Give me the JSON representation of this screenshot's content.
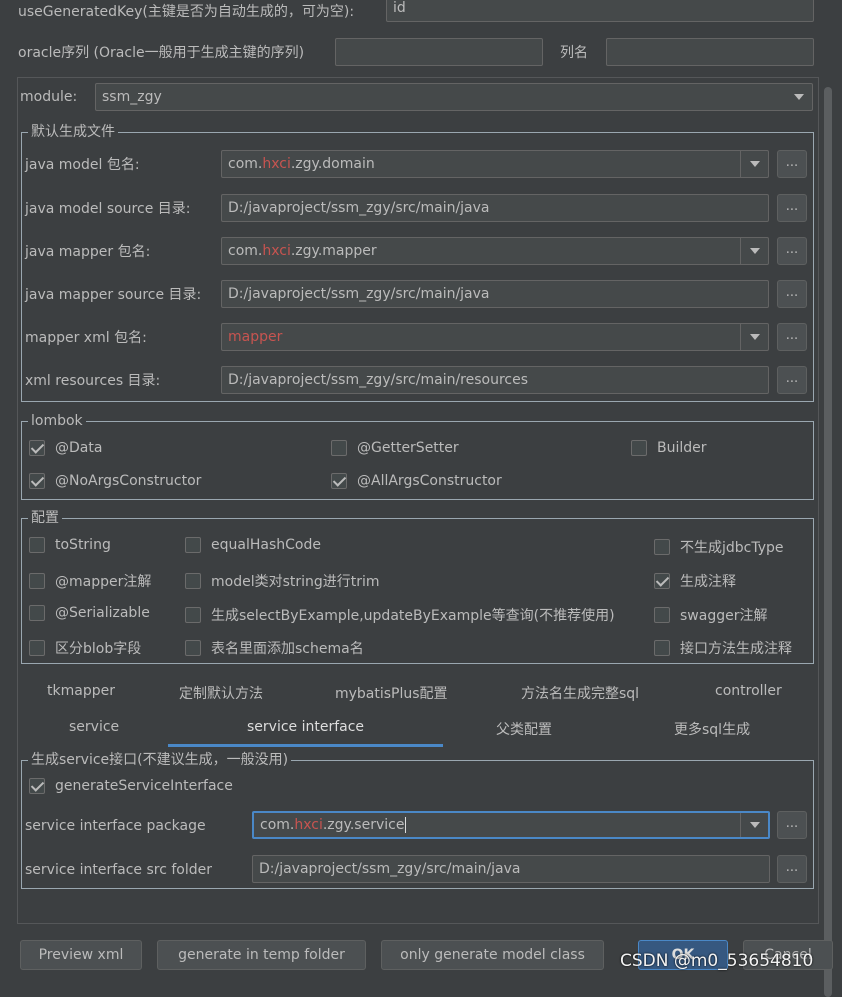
{
  "top": {
    "generated_key_label": "useGeneratedKey(主键是否为自动生成的，可为空):",
    "generated_key_value": "id",
    "oracle_label": "oracle序列 (Oracle一般用于生成主键的序列)",
    "oracle_value": "",
    "column_label": "列名",
    "column_value": ""
  },
  "module": {
    "label": "module:",
    "value": "ssm_zgy"
  },
  "default_files": {
    "title": "默认生成文件",
    "rows": [
      {
        "label": "java model 包名:",
        "pre": "com.",
        "hl": "hxci",
        "post": ".zgy.domain",
        "combo": true
      },
      {
        "label": "java model source 目录:",
        "pre": "D:/javaproject/ssm_zgy/src/main/java",
        "hl": "",
        "post": "",
        "combo": false
      },
      {
        "label": "java mapper 包名:",
        "pre": "com.",
        "hl": "hxci",
        "post": ".zgy.mapper",
        "combo": true
      },
      {
        "label": "java mapper source 目录:",
        "pre": "D:/javaproject/ssm_zgy/src/main/java",
        "hl": "",
        "post": "",
        "combo": false
      },
      {
        "label": "mapper xml 包名:",
        "pre": "",
        "hl": "mapper",
        "post": "",
        "combo": true
      },
      {
        "label": "xml resources 目录:",
        "pre": "D:/javaproject/ssm_zgy/src/main/resources",
        "hl": "",
        "post": "",
        "combo": false
      }
    ],
    "browse_label": "..."
  },
  "lombok": {
    "title": "lombok",
    "items": [
      {
        "label": "@Data",
        "checked": true
      },
      {
        "label": "@GetterSetter",
        "checked": false
      },
      {
        "label": "Builder",
        "checked": false
      },
      {
        "label": "@NoArgsConstructor",
        "checked": true
      },
      {
        "label": "@AllArgsConstructor",
        "checked": true
      }
    ]
  },
  "config": {
    "title": "配置",
    "items": [
      {
        "label": "toString",
        "checked": false
      },
      {
        "label": "equalHashCode",
        "checked": false
      },
      {
        "label": "不生成jdbcType",
        "checked": false
      },
      {
        "label": "@mapper注解",
        "checked": false
      },
      {
        "label": "model类对string进行trim",
        "checked": false
      },
      {
        "label": "生成注释",
        "checked": true
      },
      {
        "label": "@Serializable",
        "checked": false
      },
      {
        "label": "生成selectByExample,updateByExample等查询(不推荐使用)",
        "checked": false
      },
      {
        "label": "swagger注解",
        "checked": false
      },
      {
        "label": "区分blob字段",
        "checked": false
      },
      {
        "label": "表名里面添加schema名",
        "checked": false
      },
      {
        "label": "接口方法生成注释",
        "checked": false
      }
    ]
  },
  "tabs": {
    "row1": [
      "tkmapper",
      "定制默认方法",
      "mybatisPlus配置",
      "方法名生成完整sql",
      "controller"
    ],
    "row2": [
      "service",
      "service interface",
      "父类配置",
      "更多sql生成"
    ],
    "active": "service interface"
  },
  "service_interface": {
    "title": "生成service接口(不建议生成，一般没用)",
    "generate_label": "generateServiceInterface",
    "generate_checked": true,
    "package_label": "service interface package",
    "package_pre": "com.",
    "package_hl": "hxci",
    "package_post": ".zgy.service",
    "folder_label": "service interface src folder",
    "folder_value": "D:/javaproject/ssm_zgy/src/main/java"
  },
  "buttons": {
    "preview": "Preview xml",
    "temp": "generate in temp folder",
    "model_only": "only generate model class",
    "ok": "OK",
    "cancel": "Cancel"
  },
  "watermark": "CSDN @m0_53654810",
  "colors": {
    "background": "#3c3f41",
    "highlight": "#c75450",
    "focus": "#4a88c7",
    "ok_button": "#365880"
  }
}
